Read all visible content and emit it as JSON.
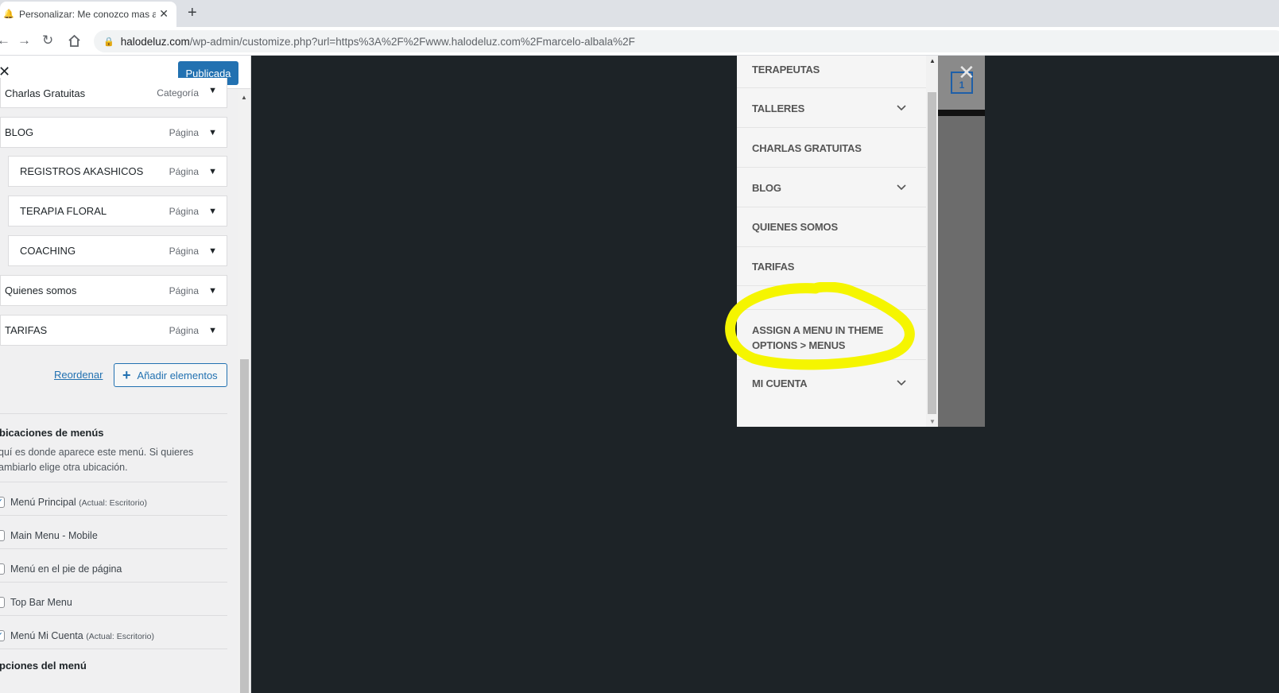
{
  "browser": {
    "tab_title": "Personalizar: Me conozco mas all",
    "tab_close": "✕",
    "new_tab": "+",
    "url_host": "halodeluz.com",
    "url_path": "/wp-admin/customize.php?url=https%3A%2F%2Fwww.halodeluz.com%2Fmarcelo-albala%2F",
    "back_icon": "arrow-left-icon",
    "forward_icon": "arrow-right-icon",
    "reload_icon": "reload-icon",
    "home_icon": "home-icon"
  },
  "customizer": {
    "close_symbol": "✕",
    "publish_label": "Publicada",
    "menu_items": [
      {
        "title": "Charlas Gratuitas",
        "type": "Categoría"
      },
      {
        "title": "BLOG",
        "type": "Página"
      },
      {
        "title": "REGISTROS AKASHICOS",
        "type": "Página"
      },
      {
        "title": "TERAPIA FLORAL",
        "type": "Página"
      },
      {
        "title": "COACHING",
        "type": "Página"
      },
      {
        "title": "Quienes somos",
        "type": "Página"
      },
      {
        "title": "TARIFAS",
        "type": "Página"
      }
    ],
    "reorder_label": "Reordenar",
    "add_items_label": "Añadir elementos",
    "locations_title": "bicaciones de menús",
    "locations_desc": "quí es donde aparece este menú. Si quieres ambiarlo elige otra ubicación.",
    "locations": [
      {
        "label": "Menú Principal",
        "note": "(Actual: Escritorio)",
        "checked": true
      },
      {
        "label": "Main Menu - Mobile",
        "note": "",
        "checked": false
      },
      {
        "label": "Menú en el pie de página",
        "note": "",
        "checked": false
      },
      {
        "label": "Top Bar Menu",
        "note": "",
        "checked": false
      },
      {
        "label": "Menú Mi Cuenta",
        "note": "(Actual: Escritorio)",
        "checked": true
      }
    ],
    "options_title": "pciones del menú"
  },
  "preview": {
    "cart_count": "1",
    "close_symbol": "✕",
    "mobile_menu": [
      {
        "label": "TERAPEUTAS",
        "has_submenu": false
      },
      {
        "label": "TALLERES",
        "has_submenu": true
      },
      {
        "label": "CHARLAS GRATUITAS",
        "has_submenu": false
      },
      {
        "label": "BLOG",
        "has_submenu": true
      },
      {
        "label": "QUIENES SOMOS",
        "has_submenu": false
      },
      {
        "label": "TARIFAS",
        "has_submenu": false
      },
      {
        "label": "ASSIGN A MENU IN THEME OPTIONS > MENUS",
        "has_submenu": false
      },
      {
        "label": "MI CUENTA",
        "has_submenu": true
      }
    ],
    "highlight_color": "#f5f500"
  }
}
